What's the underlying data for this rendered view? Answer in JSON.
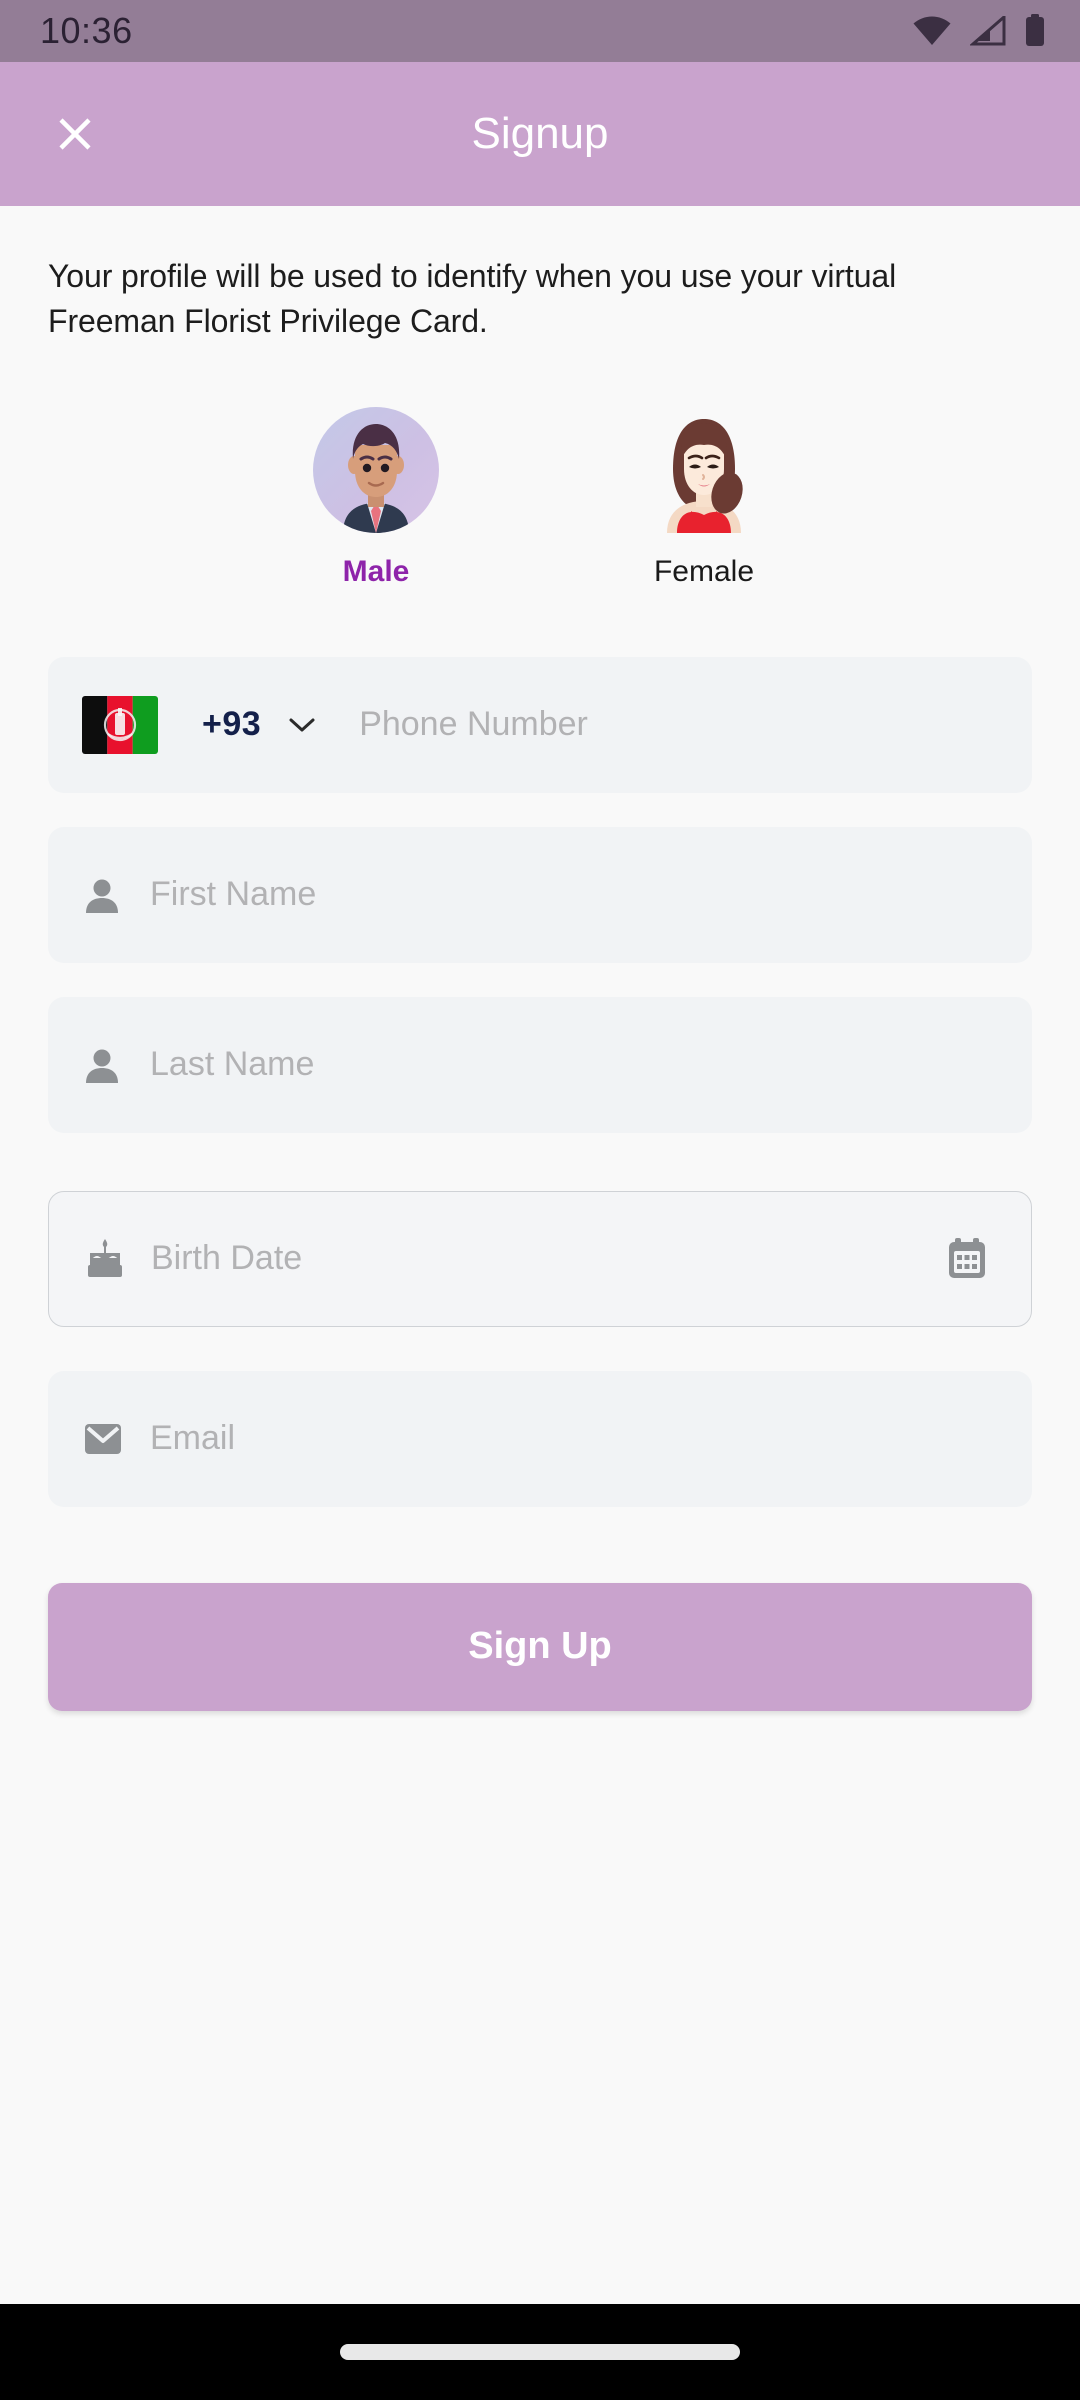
{
  "status_bar": {
    "time": "10:36",
    "icons": [
      "wifi-icon",
      "cellular-signal-icon",
      "battery-icon"
    ]
  },
  "app_bar": {
    "title": "Signup",
    "close_icon": "close-icon"
  },
  "intro": {
    "text": "Your profile will be used to identify when you use your virtual Freeman Florist Privilege Card."
  },
  "gender": {
    "selected": "Male",
    "options": [
      {
        "label": "Male",
        "selected": true,
        "avatar": "male-avatar"
      },
      {
        "label": "Female",
        "selected": false,
        "avatar": "female-avatar"
      }
    ],
    "selected_color": "#8e24aa",
    "unselected_color": "#1a1a1a"
  },
  "form": {
    "phone": {
      "flag": "afghanistan-flag-icon",
      "country_code": "+93",
      "caret_icon": "chevron-down-icon",
      "placeholder": "Phone Number",
      "value": ""
    },
    "first_name": {
      "icon": "person-icon",
      "placeholder": "First Name",
      "value": ""
    },
    "last_name": {
      "icon": "person-icon",
      "placeholder": "Last Name",
      "value": ""
    },
    "birth_date": {
      "icon": "birthday-cake-icon",
      "placeholder": "Birth Date",
      "value": "",
      "trailing_icon": "calendar-icon"
    },
    "email": {
      "icon": "envelope-icon",
      "placeholder": "Email",
      "value": ""
    }
  },
  "actions": {
    "sign_up_label": "Sign Up"
  },
  "colors": {
    "status_bar": "#937d96",
    "app_bar": "#c9a3cd",
    "accent": "#c9a3cd",
    "page_background": "#f9f9f9",
    "field_background": "#f1f3f5",
    "placeholder": "#b2b2b4",
    "country_code": "#14204a"
  }
}
